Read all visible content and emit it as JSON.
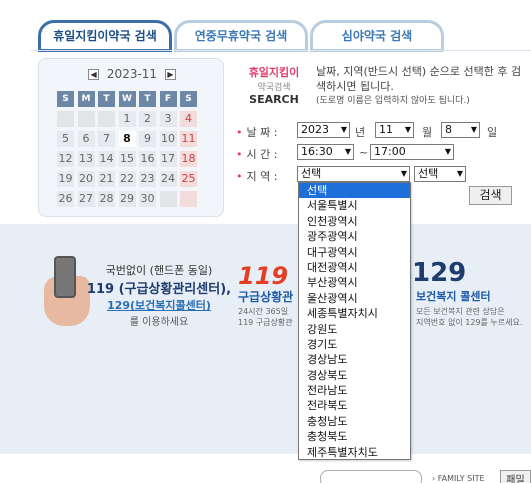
{
  "tabs": [
    {
      "label": "휴일지킴이약국 검색",
      "active": true
    },
    {
      "label": "연중무휴약국 검색",
      "active": false
    },
    {
      "label": "심야약국 검색",
      "active": false
    }
  ],
  "calendar": {
    "month_label": "2023-11",
    "dow": [
      "S",
      "M",
      "T",
      "W",
      "T",
      "F",
      "S"
    ],
    "weeks": [
      [
        "",
        "",
        "",
        "1",
        "2",
        "3",
        "4"
      ],
      [
        "5",
        "6",
        "7",
        "8",
        "9",
        "10",
        "11"
      ],
      [
        "12",
        "13",
        "14",
        "15",
        "16",
        "17",
        "18"
      ],
      [
        "19",
        "20",
        "21",
        "22",
        "23",
        "24",
        "25"
      ],
      [
        "26",
        "27",
        "28",
        "29",
        "30",
        "",
        ""
      ]
    ],
    "today": "8"
  },
  "brand": {
    "line1": "휴일지킴이",
    "line2": "약국검색",
    "line3": "SEARCH"
  },
  "description": {
    "text": "날짜, 지역(반드시 선택) 순으로 선택한 후 검색하시면 됩니다.",
    "note": "(도로명 이름은 입력하지 않아도 됩니다.)"
  },
  "form": {
    "date_label": "날 짜 :",
    "time_label": "시 간 :",
    "region_label": "지 역 :",
    "year": "2023",
    "year_unit": "년",
    "month": "11",
    "month_unit": "월",
    "day": "8",
    "day_unit": "일",
    "time_from": "16:30",
    "time_sep": "~",
    "time_to": "17:00",
    "region1": "선택",
    "region2": "선택",
    "search_button": "검색"
  },
  "region_options": [
    "선택",
    "서울특별시",
    "인천광역시",
    "광주광역시",
    "대구광역시",
    "대전광역시",
    "부산광역시",
    "울산광역시",
    "세종특별자치시",
    "강원도",
    "경기도",
    "경상남도",
    "경상북도",
    "전라남도",
    "전라북도",
    "충청남도",
    "충청북도",
    "제주특별자치도"
  ],
  "info": {
    "left_l1": "국번없이 (핸드폰 동일)",
    "left_l2": "119 (구급상황관리센터),",
    "left_l3": "129(보건복지콜센터)",
    "left_l4": "를 이용하세요",
    "mid_big": "119",
    "mid_t1": "구급상황관",
    "mid_t2a": "24시간 365일",
    "mid_t2b": "119 구급상황관",
    "right_big": "129",
    "right_t1": "보건복지 콜센터",
    "right_t2a": "모든 보건복지 관련 상담은",
    "right_t2b": "지역번호 없이 129를 누르세요."
  },
  "footer": {
    "family_site": "› FAMILY SITE",
    "go": "패밀"
  }
}
